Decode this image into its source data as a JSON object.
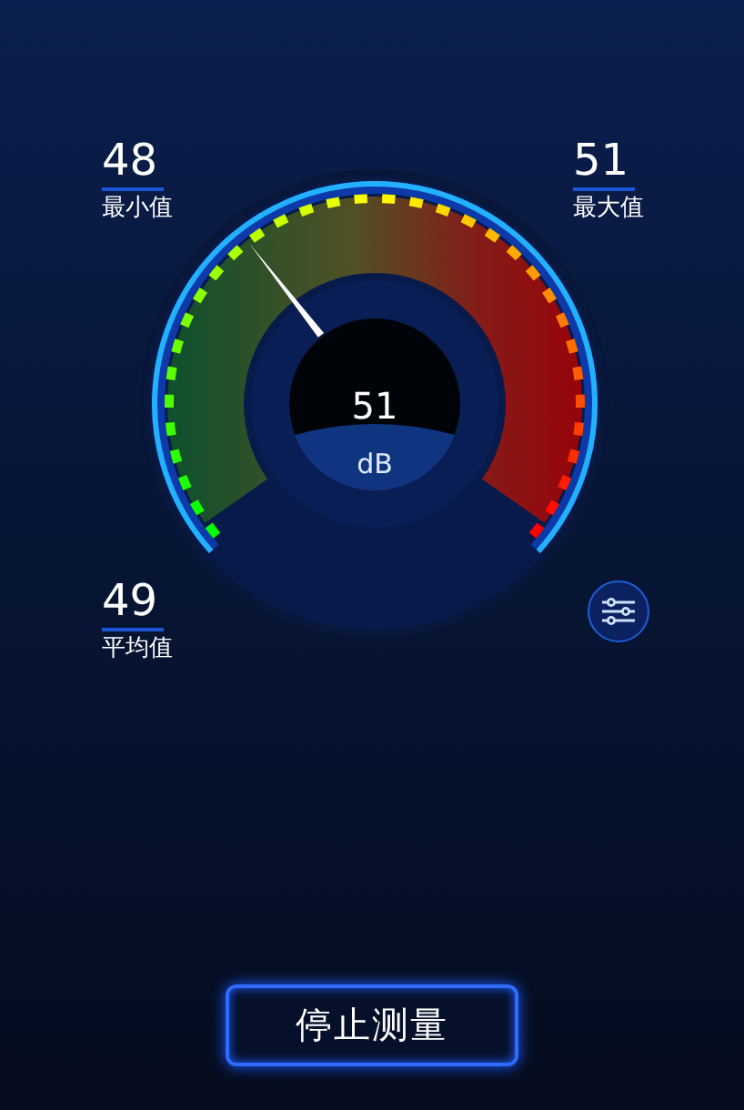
{
  "stats": [
    {
      "kind": "min",
      "value": "48",
      "label": "最小值"
    },
    {
      "kind": "max",
      "value": "51",
      "label": "最大值"
    },
    {
      "kind": "avg",
      "value": "49",
      "label": "平均值"
    }
  ],
  "gauge": {
    "value": "51",
    "unit": "dB"
  },
  "button": "停止测量"
}
